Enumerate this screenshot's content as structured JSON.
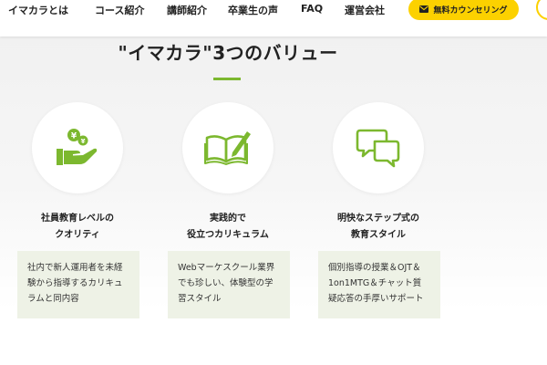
{
  "nav": {
    "items": [
      "イマカラとは",
      "コース紹介",
      "講師紹介",
      "卒業生の声",
      "FAQ",
      "運営会社"
    ],
    "cta_label": "無料カウンセリング"
  },
  "section": {
    "title": "\"イマカラ\"3つのバリュー"
  },
  "values": [
    {
      "icon": "hand-coin-icon",
      "label_line1": "社員教育レベルの",
      "label_line2": "クオリティ",
      "desc_line1": "社内で新人運用者を未経",
      "desc_line2": "験から指導するカリキュ",
      "desc_line3": "ラムと同内容"
    },
    {
      "icon": "book-pen-icon",
      "label_line1": "実践的で",
      "label_line2": "役立つカリキュラム",
      "desc_line1": "Webマーケスクール業界",
      "desc_line2": "でも珍しい、体験型の学",
      "desc_line3": "習スタイル"
    },
    {
      "icon": "chat-bubbles-icon",
      "label_line1": "明快なステップ式の",
      "label_line2": "教育スタイル",
      "desc_line1": "個別指導の授業＆OJT＆",
      "desc_line2": "1on1MTG＆チャット質",
      "desc_line3": "疑応答の手厚いサポート"
    }
  ],
  "colors": {
    "accent_green": "#7cb82f",
    "cta_yellow": "#fcd100",
    "desc_bg": "#eef2e6"
  }
}
